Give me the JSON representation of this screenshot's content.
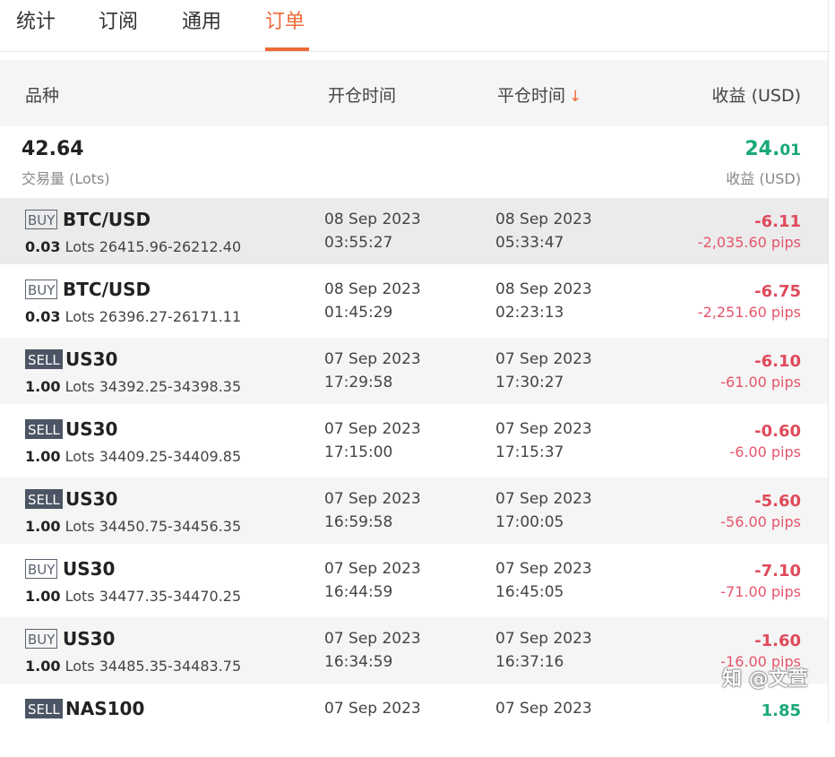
{
  "tabs": [
    "统计",
    "订阅",
    "通用",
    "订单"
  ],
  "header": {
    "col_symbol": "品种",
    "col_open": "开仓时间",
    "col_close": "平仓时间",
    "sort_arrow": "↓",
    "col_profit": "收益 (USD)"
  },
  "summary": {
    "lots": "42.64",
    "lots_label": "交易量 (Lots)",
    "profit_int": "24.",
    "profit_dec": "01",
    "profit_label": "收益 (USD)"
  },
  "orders": [
    {
      "side": "BUY",
      "symbol": "BTC/USD",
      "lots": "0.03",
      "lots_unit": "Lots",
      "range": "26415.96-26212.40",
      "open_date": "08 Sep 2023",
      "open_time": "03:55:27",
      "close_date": "08 Sep 2023",
      "close_time": "05:33:47",
      "profit": "-6.11",
      "pips": "-2,035.60 pips"
    },
    {
      "side": "BUY",
      "symbol": "BTC/USD",
      "lots": "0.03",
      "lots_unit": "Lots",
      "range": "26396.27-26171.11",
      "open_date": "08 Sep 2023",
      "open_time": "01:45:29",
      "close_date": "08 Sep 2023",
      "close_time": "02:23:13",
      "profit": "-6.75",
      "pips": "-2,251.60 pips"
    },
    {
      "side": "SELL",
      "symbol": "US30",
      "lots": "1.00",
      "lots_unit": "Lots",
      "range": "34392.25-34398.35",
      "open_date": "07 Sep 2023",
      "open_time": "17:29:58",
      "close_date": "07 Sep 2023",
      "close_time": "17:30:27",
      "profit": "-6.10",
      "pips": "-61.00 pips"
    },
    {
      "side": "SELL",
      "symbol": "US30",
      "lots": "1.00",
      "lots_unit": "Lots",
      "range": "34409.25-34409.85",
      "open_date": "07 Sep 2023",
      "open_time": "17:15:00",
      "close_date": "07 Sep 2023",
      "close_time": "17:15:37",
      "profit": "-0.60",
      "pips": "-6.00 pips"
    },
    {
      "side": "SELL",
      "symbol": "US30",
      "lots": "1.00",
      "lots_unit": "Lots",
      "range": "34450.75-34456.35",
      "open_date": "07 Sep 2023",
      "open_time": "16:59:58",
      "close_date": "07 Sep 2023",
      "close_time": "17:00:05",
      "profit": "-5.60",
      "pips": "-56.00 pips"
    },
    {
      "side": "BUY",
      "symbol": "US30",
      "lots": "1.00",
      "lots_unit": "Lots",
      "range": "34477.35-34470.25",
      "open_date": "07 Sep 2023",
      "open_time": "16:44:59",
      "close_date": "07 Sep 2023",
      "close_time": "16:45:05",
      "profit": "-7.10",
      "pips": "-71.00 pips"
    },
    {
      "side": "BUY",
      "symbol": "US30",
      "lots": "1.00",
      "lots_unit": "Lots",
      "range": "34485.35-34483.75",
      "open_date": "07 Sep 2023",
      "open_time": "16:34:59",
      "close_date": "07 Sep 2023",
      "close_time": "16:37:16",
      "profit": "-1.60",
      "pips": "-16.00 pips"
    },
    {
      "side": "SELL",
      "symbol": "NAS100",
      "lots": "",
      "lots_unit": "",
      "range": "",
      "open_date": "07 Sep 2023",
      "open_time": "",
      "close_date": "07 Sep 2023",
      "close_time": "",
      "profit": "1.85",
      "pips": ""
    }
  ],
  "watermark": "知 @文萱",
  "colors": {
    "accent": "#ee6a36",
    "loss": "#e04a5a",
    "gain": "#1aa87a",
    "sell_badge": "#4b5564"
  }
}
